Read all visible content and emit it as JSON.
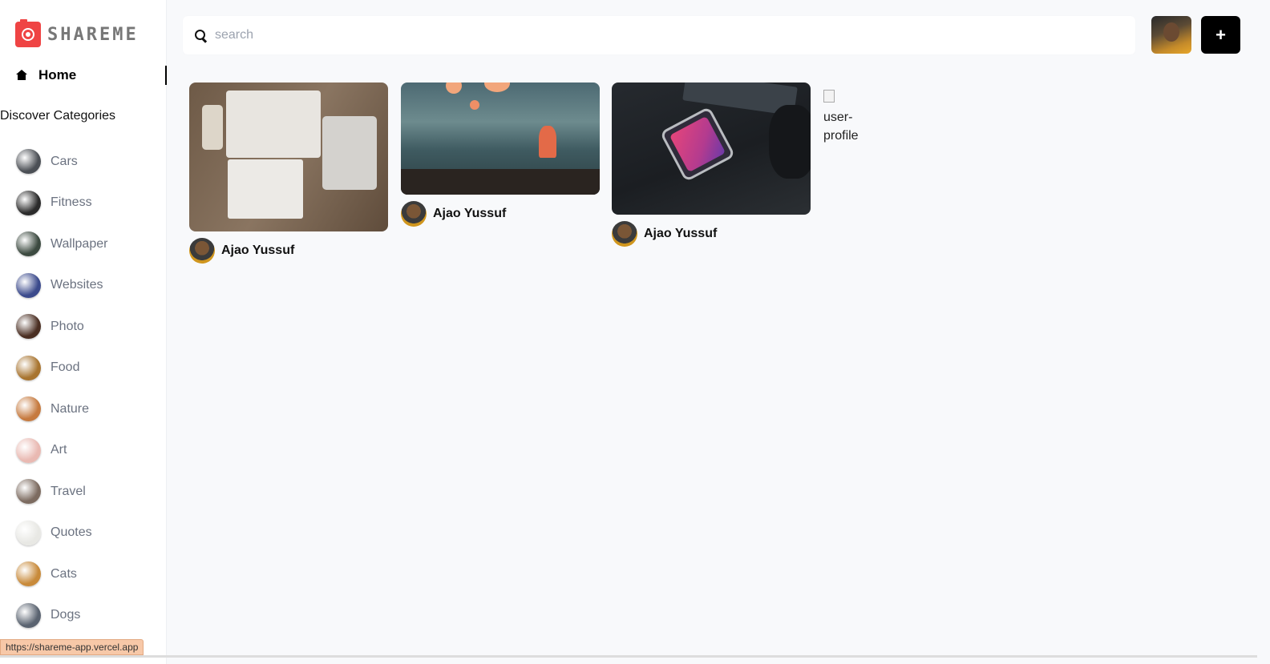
{
  "app": {
    "logo_text": "SHAREME"
  },
  "sidebar": {
    "home_label": "Home",
    "discover_heading": "Discover Categories",
    "categories": [
      {
        "label": "Cars",
        "color": "#4b4f55"
      },
      {
        "label": "Fitness",
        "color": "#2b2b2b"
      },
      {
        "label": "Wallpaper",
        "color": "#3c4a40"
      },
      {
        "label": "Websites",
        "color": "#3b4a8c"
      },
      {
        "label": "Photo",
        "color": "#4a2e22"
      },
      {
        "label": "Food",
        "color": "#a8742f"
      },
      {
        "label": "Nature",
        "color": "#c67a3f"
      },
      {
        "label": "Art",
        "color": "#e9b9b2"
      },
      {
        "label": "Travel",
        "color": "#7c6b60"
      },
      {
        "label": "Quotes",
        "color": "#e8e8e4"
      },
      {
        "label": "Cats",
        "color": "#c88a3a"
      },
      {
        "label": "Dogs",
        "color": "#5a6370"
      }
    ]
  },
  "header": {
    "search_placeholder": "search",
    "add_button_label": "+"
  },
  "pins": [
    {
      "author": "Ajao Yussuf",
      "image": "devices-flatlay"
    },
    {
      "author": "Ajao Yussuf",
      "image": "lofi-room"
    },
    {
      "author": "Ajao Yussuf",
      "image": "phone-desk"
    }
  ],
  "broken_image_alt": "user-profile",
  "status_url": "https://shareme-app.vercel.app",
  "colors": {
    "brand": "#ef4444",
    "accent": "#000000",
    "muted_text": "#6b7280"
  }
}
